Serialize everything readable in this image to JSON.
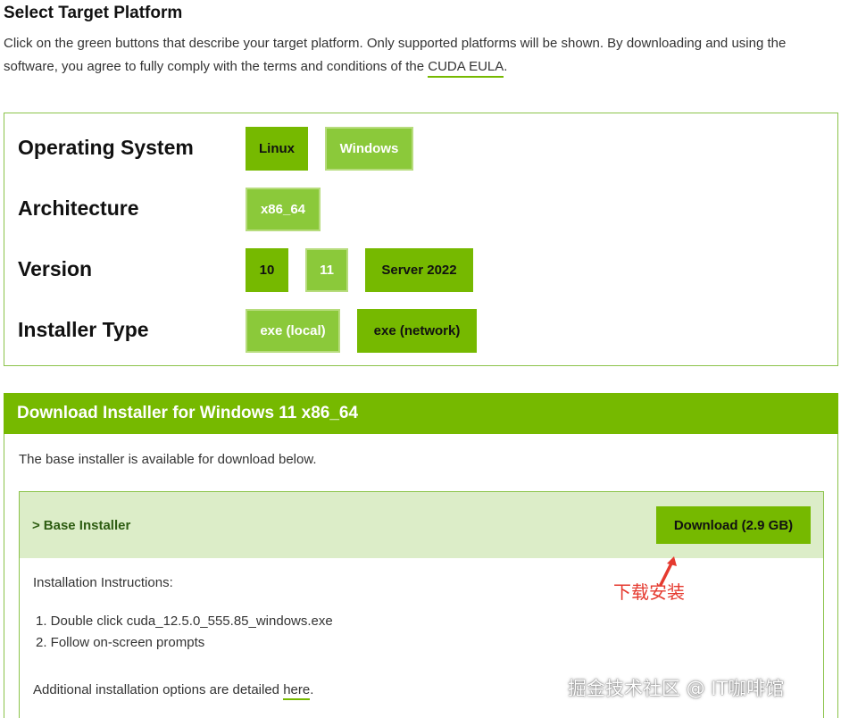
{
  "header": {
    "title": "Select Target Platform",
    "intro_text": "Click on the green buttons that describe your target platform. Only supported platforms will be shown. By downloading and using the software, you agree to fully comply with the terms and conditions of the ",
    "eula_link": "CUDA EULA",
    "intro_end": "."
  },
  "selector": {
    "os": {
      "label": "Operating System",
      "options": [
        "Linux",
        "Windows"
      ],
      "selected": "Windows"
    },
    "arch": {
      "label": "Architecture",
      "options": [
        "x86_64"
      ],
      "selected": "x86_64"
    },
    "version": {
      "label": "Version",
      "options": [
        "10",
        "11",
        "Server 2022"
      ],
      "selected": "11"
    },
    "installer_type": {
      "label": "Installer Type",
      "options": [
        "exe (local)",
        "exe (network)"
      ],
      "selected": "exe (local)"
    }
  },
  "download": {
    "header": "Download Installer for Windows 11 x86_64",
    "description": "The base installer is available for download below.",
    "base_installer": {
      "title": "Base Installer",
      "chevron": ">",
      "button_label": "Download (2.9 GB)",
      "instructions_label": "Installation Instructions:",
      "steps": [
        "1. Double click cuda_12.5.0_555.85_windows.exe",
        "2. Follow on-screen prompts"
      ],
      "additional_text": "Additional installation options are detailed ",
      "here_link": "here",
      "additional_end": "."
    }
  },
  "annotation": {
    "text": "下载安装",
    "color": "#e53a2f"
  },
  "watermark": {
    "text": "掘金技术社区 @ IT咖啡馆"
  },
  "colors": {
    "accent": "#76b900",
    "unselected": "#8bc93a",
    "installer_header_bg": "#dcedc8"
  }
}
